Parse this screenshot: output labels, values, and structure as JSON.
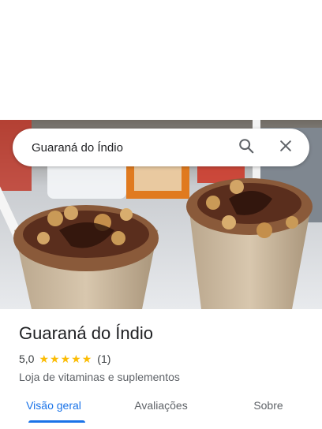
{
  "search": {
    "query": "Guaraná do Índio",
    "search_icon": "search-icon",
    "clear_icon": "close-icon"
  },
  "hero": {
    "image": "photo of two cups of açaí-style cream topped with peanuts, chocolate sauce and straws"
  },
  "place": {
    "name": "Guaraná do Índio",
    "rating": "5,0",
    "stars": 5,
    "reviews_count": "(1)",
    "category": "Loja de vitaminas e suplementos"
  },
  "tabs": [
    {
      "label": "Visão geral",
      "active": true
    },
    {
      "label": "Avaliações",
      "active": false
    },
    {
      "label": "Sobre",
      "active": false
    }
  ],
  "colors": {
    "accent": "#1a73e8",
    "star": "#fbbc04",
    "text": "#202124",
    "secondary": "#5f6368"
  }
}
